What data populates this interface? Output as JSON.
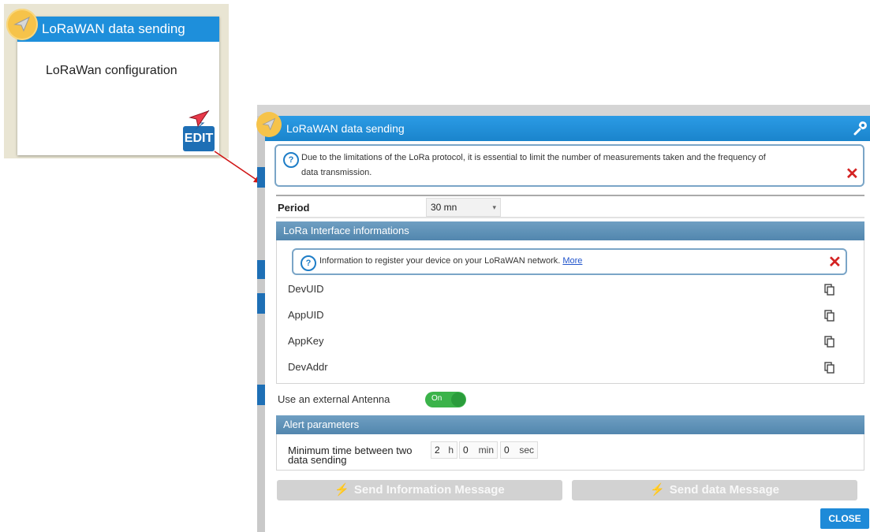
{
  "tile": {
    "title": "LoRaWAN data sending",
    "subtitle": "LoRaWan configuration",
    "edit_label": "EDIT",
    "badge_icon": "paper-plane-icon",
    "colors": {
      "header": "#1e8fdb",
      "edit": "#1e6fb5",
      "badge": "#f6c34a"
    }
  },
  "dialog": {
    "title": "LoRaWAN data sending",
    "header_icon": "wrench-icon",
    "notice": {
      "line1": "Due to the limitations of the LoRa protocol, it is essential to limit the number of measurements taken and the frequency of",
      "line2": "data transmission."
    },
    "period": {
      "label": "Period",
      "value": "30 mn"
    },
    "lora": {
      "title": "LoRa Interface informations",
      "info_text": "Information to register your device on your LoRaWAN network.",
      "more_link": "More",
      "rows": [
        {
          "label": "DevUID"
        },
        {
          "label": "AppUID"
        },
        {
          "label": "AppKey"
        },
        {
          "label": "DevAddr"
        }
      ]
    },
    "antenna": {
      "label": "Use an external Antenna",
      "toggle_label": "On",
      "enabled": true
    },
    "alert": {
      "title": "Alert parameters",
      "min_time_label_1": "Minimum time between two",
      "min_time_label_2": "data sending",
      "hours": "2",
      "hours_unit": "h",
      "minutes": "0",
      "minutes_unit": "min",
      "seconds": "0",
      "seconds_unit": "sec"
    },
    "buttons": {
      "send_info": "Send Information Message",
      "send_data": "Send data Message",
      "close": "CLOSE"
    },
    "colors": {
      "header": "#1a84cc",
      "section": "#5286ae",
      "close": "#1e8ad8",
      "toggle_on": "#3bb34a",
      "error_x": "#d42323"
    }
  }
}
